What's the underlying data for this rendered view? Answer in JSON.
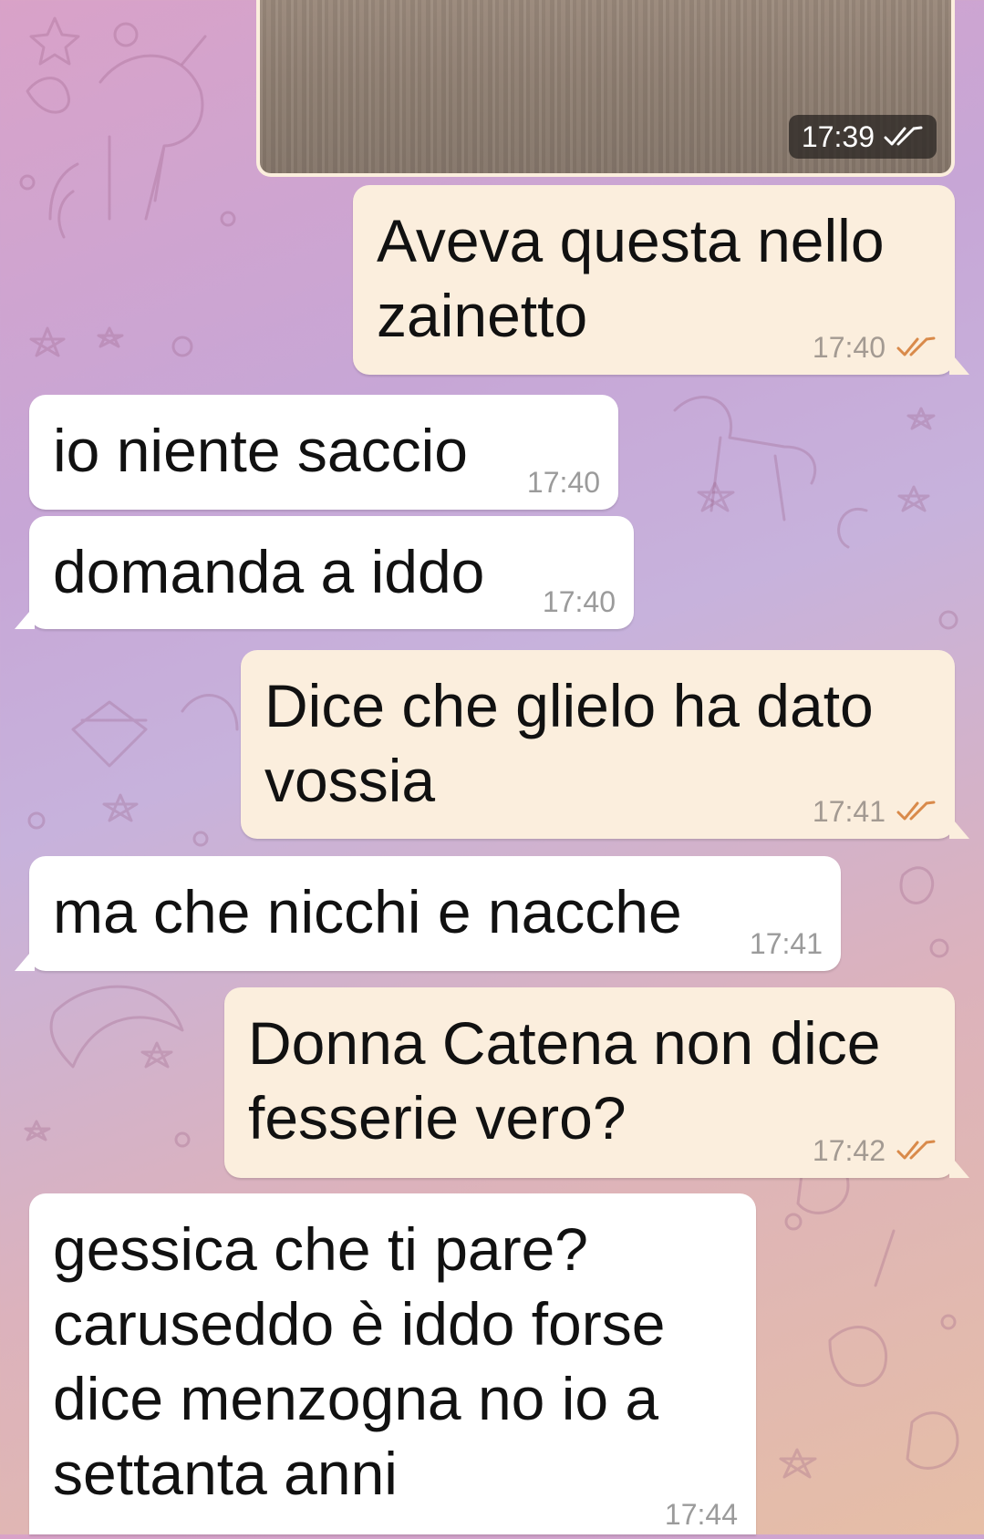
{
  "colors": {
    "outgoing_bubble": "#fbeedd",
    "incoming_bubble": "#ffffff",
    "read_ticks": "#d98a4a",
    "photo_ticks": "#ffffff"
  },
  "photo": {
    "time": "17:39",
    "status_icon": "double-check-icon"
  },
  "messages": [
    {
      "direction": "out",
      "text": "Aveva questa nello zainetto",
      "time": "17:40",
      "status_icon": "double-check-icon"
    },
    {
      "direction": "in",
      "text": "io niente saccio",
      "time": "17:40"
    },
    {
      "direction": "in",
      "text": "domanda a iddo",
      "time": "17:40"
    },
    {
      "direction": "out",
      "text": "Dice che glielo ha dato vossia",
      "time": "17:41",
      "status_icon": "double-check-icon"
    },
    {
      "direction": "in",
      "text": "ma che nicchi e nacche",
      "time": "17:41"
    },
    {
      "direction": "out",
      "text": "Donna Catena non dice fesserie vero?",
      "time": "17:42",
      "status_icon": "double-check-icon"
    },
    {
      "direction": "in",
      "text": "gessica che ti pare? caruseddo è iddo forse dice menzogna no io a settanta anni",
      "time": "17:44"
    }
  ]
}
